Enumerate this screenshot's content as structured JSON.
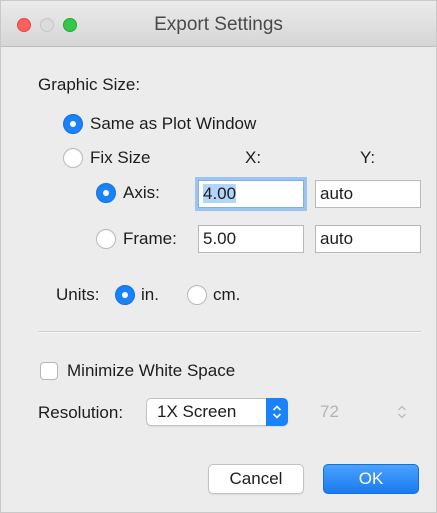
{
  "window": {
    "title": "Export Settings"
  },
  "graphic_size": {
    "heading": "Graphic Size:",
    "same_as_plot": {
      "label": "Same as Plot Window",
      "selected": true
    },
    "fix_size": {
      "label": "Fix Size",
      "selected": false
    },
    "x_header": "X:",
    "y_header": "Y:",
    "axis": {
      "label": "Axis:",
      "selected": true,
      "x_value": "4.00",
      "y_value": "auto"
    },
    "frame": {
      "label": "Frame:",
      "selected": false,
      "x_value": "5.00",
      "y_value": "auto"
    }
  },
  "units": {
    "label": "Units:",
    "in": {
      "label": "in.",
      "selected": true
    },
    "cm": {
      "label": "cm.",
      "selected": false
    }
  },
  "minimize_white_space": {
    "label": "Minimize White Space",
    "checked": false
  },
  "resolution": {
    "label": "Resolution:",
    "selected": "1X Screen",
    "dpi": "72"
  },
  "buttons": {
    "cancel": "Cancel",
    "ok": "OK"
  },
  "colors": {
    "accent": "#1a82fb",
    "window_bg": "#ececec"
  }
}
